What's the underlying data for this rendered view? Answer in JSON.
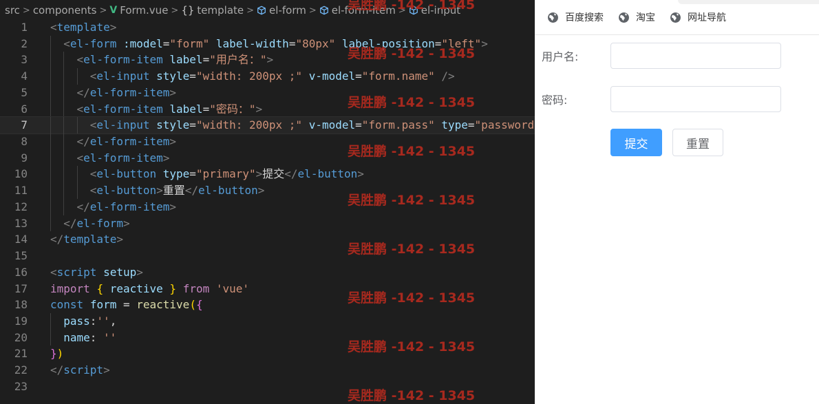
{
  "breadcrumb": {
    "items": [
      "src",
      "components",
      "Form.vue",
      "template",
      "el-form",
      "el-form-item",
      "el-input"
    ]
  },
  "code": {
    "current_line": 7,
    "lines": [
      {
        "n": "1",
        "indent": 0,
        "tokens": [
          [
            "punc",
            "<"
          ],
          [
            "tag",
            "template"
          ],
          [
            "punc",
            ">"
          ]
        ]
      },
      {
        "n": "2",
        "indent": 1,
        "tokens": [
          [
            "punc",
            "<"
          ],
          [
            "tag",
            "el-form"
          ],
          [
            "txt",
            " "
          ],
          [
            "attr",
            ":model"
          ],
          [
            "txt",
            "="
          ],
          [
            "str",
            "\"form\""
          ],
          [
            "txt",
            " "
          ],
          [
            "attr",
            "label-width"
          ],
          [
            "txt",
            "="
          ],
          [
            "str",
            "\"80px\""
          ],
          [
            "txt",
            " "
          ],
          [
            "attr",
            "label-position"
          ],
          [
            "txt",
            "="
          ],
          [
            "str",
            "\"left\""
          ],
          [
            "punc",
            ">"
          ]
        ]
      },
      {
        "n": "3",
        "indent": 2,
        "tokens": [
          [
            "punc",
            "<"
          ],
          [
            "tag",
            "el-form-item"
          ],
          [
            "txt",
            " "
          ],
          [
            "attr",
            "label"
          ],
          [
            "txt",
            "="
          ],
          [
            "str",
            "\"用户名：\""
          ],
          [
            "punc",
            ">"
          ]
        ]
      },
      {
        "n": "4",
        "indent": 3,
        "tokens": [
          [
            "punc",
            "<"
          ],
          [
            "tag",
            "el-input"
          ],
          [
            "txt",
            " "
          ],
          [
            "attr",
            "style"
          ],
          [
            "txt",
            "="
          ],
          [
            "str",
            "\"width: 200px ;\""
          ],
          [
            "txt",
            " "
          ],
          [
            "attr",
            "v-model"
          ],
          [
            "txt",
            "="
          ],
          [
            "str",
            "\"form.name\""
          ],
          [
            "txt",
            " "
          ],
          [
            "punc",
            "/>"
          ]
        ]
      },
      {
        "n": "5",
        "indent": 2,
        "tokens": [
          [
            "punc",
            "</"
          ],
          [
            "tag",
            "el-form-item"
          ],
          [
            "punc",
            ">"
          ]
        ]
      },
      {
        "n": "6",
        "indent": 2,
        "tokens": [
          [
            "punc",
            "<"
          ],
          [
            "tag",
            "el-form-item"
          ],
          [
            "txt",
            " "
          ],
          [
            "attr",
            "label"
          ],
          [
            "txt",
            "="
          ],
          [
            "str",
            "\"密码：\""
          ],
          [
            "punc",
            ">"
          ]
        ]
      },
      {
        "n": "7",
        "indent": 3,
        "tokens": [
          [
            "punc",
            "<"
          ],
          [
            "tag",
            "el-input"
          ],
          [
            "txt",
            " "
          ],
          [
            "attr",
            "style"
          ],
          [
            "txt",
            "="
          ],
          [
            "str",
            "\"width: 200px ;\""
          ],
          [
            "txt",
            " "
          ],
          [
            "attr",
            "v-model"
          ],
          [
            "txt",
            "="
          ],
          [
            "str",
            "\"form.pass\""
          ],
          [
            "txt",
            " "
          ],
          [
            "attr",
            "type"
          ],
          [
            "txt",
            "="
          ],
          [
            "str",
            "\"password"
          ]
        ]
      },
      {
        "n": "8",
        "indent": 2,
        "tokens": [
          [
            "punc",
            "</"
          ],
          [
            "tag",
            "el-form-item"
          ],
          [
            "punc",
            ">"
          ]
        ]
      },
      {
        "n": "9",
        "indent": 2,
        "tokens": [
          [
            "punc",
            "<"
          ],
          [
            "tag",
            "el-form-item"
          ],
          [
            "punc",
            ">"
          ]
        ]
      },
      {
        "n": "10",
        "indent": 3,
        "tokens": [
          [
            "punc",
            "<"
          ],
          [
            "tag",
            "el-button"
          ],
          [
            "txt",
            " "
          ],
          [
            "attr",
            "type"
          ],
          [
            "txt",
            "="
          ],
          [
            "str",
            "\"primary\""
          ],
          [
            "punc",
            ">"
          ],
          [
            "txt",
            "提交"
          ],
          [
            "punc",
            "</"
          ],
          [
            "tag",
            "el-button"
          ],
          [
            "punc",
            ">"
          ]
        ]
      },
      {
        "n": "11",
        "indent": 3,
        "tokens": [
          [
            "punc",
            "<"
          ],
          [
            "tag",
            "el-button"
          ],
          [
            "punc",
            ">"
          ],
          [
            "txt",
            "重置"
          ],
          [
            "punc",
            "</"
          ],
          [
            "tag",
            "el-button"
          ],
          [
            "punc",
            ">"
          ]
        ]
      },
      {
        "n": "12",
        "indent": 2,
        "tokens": [
          [
            "punc",
            "</"
          ],
          [
            "tag",
            "el-form-item"
          ],
          [
            "punc",
            ">"
          ]
        ]
      },
      {
        "n": "13",
        "indent": 1,
        "tokens": [
          [
            "punc",
            "</"
          ],
          [
            "tag",
            "el-form"
          ],
          [
            "punc",
            ">"
          ]
        ]
      },
      {
        "n": "14",
        "indent": 0,
        "tokens": [
          [
            "punc",
            "</"
          ],
          [
            "tag",
            "template"
          ],
          [
            "punc",
            ">"
          ]
        ]
      },
      {
        "n": "15",
        "indent": 0,
        "tokens": []
      },
      {
        "n": "16",
        "indent": 0,
        "tokens": [
          [
            "punc",
            "<"
          ],
          [
            "tag",
            "script"
          ],
          [
            "txt",
            " "
          ],
          [
            "attr",
            "setup"
          ],
          [
            "punc",
            ">"
          ]
        ]
      },
      {
        "n": "17",
        "indent": 0,
        "tokens": [
          [
            "kw",
            "import"
          ],
          [
            "txt",
            " "
          ],
          [
            "br1",
            "{"
          ],
          [
            "txt",
            " "
          ],
          [
            "var",
            "reactive"
          ],
          [
            "txt",
            " "
          ],
          [
            "br1",
            "}"
          ],
          [
            "txt",
            " "
          ],
          [
            "kw",
            "from"
          ],
          [
            "txt",
            " "
          ],
          [
            "str",
            "'vue'"
          ]
        ]
      },
      {
        "n": "18",
        "indent": 0,
        "tokens": [
          [
            "tag",
            "const"
          ],
          [
            "txt",
            " "
          ],
          [
            "var",
            "form"
          ],
          [
            "txt",
            " = "
          ],
          [
            "fn",
            "reactive"
          ],
          [
            "br1",
            "("
          ],
          [
            "br2",
            "{"
          ]
        ]
      },
      {
        "n": "19",
        "indent": 1,
        "tokens": [
          [
            "var",
            "pass"
          ],
          [
            "txt",
            ":"
          ],
          [
            "str",
            "''"
          ],
          [
            "txt",
            ","
          ]
        ]
      },
      {
        "n": "20",
        "indent": 1,
        "tokens": [
          [
            "var",
            "name"
          ],
          [
            "txt",
            ": "
          ],
          [
            "str",
            "''"
          ]
        ]
      },
      {
        "n": "21",
        "indent": 0,
        "tokens": [
          [
            "br2",
            "}"
          ],
          [
            "br1",
            ")"
          ]
        ]
      },
      {
        "n": "22",
        "indent": 0,
        "tokens": [
          [
            "punc",
            "</"
          ],
          [
            "tag",
            "script"
          ],
          [
            "punc",
            ">"
          ]
        ]
      },
      {
        "n": "23",
        "indent": 0,
        "tokens": []
      }
    ]
  },
  "watermark": {
    "text": "吴胜鹏 -142 - 1345",
    "repeat": 9
  },
  "preview": {
    "bookmarks": [
      {
        "label": "百度搜索",
        "icon": "globe-icon"
      },
      {
        "label": "淘宝",
        "icon": "globe-icon"
      },
      {
        "label": "网址导航",
        "icon": "globe-icon"
      }
    ],
    "form": {
      "username_label": "用户名:",
      "username_value": "",
      "password_label": "密码:",
      "password_value": "",
      "submit_label": "提交",
      "reset_label": "重置"
    },
    "colors": {
      "primary": "#409eff",
      "border": "#dcdfe6",
      "label": "#606266"
    }
  }
}
